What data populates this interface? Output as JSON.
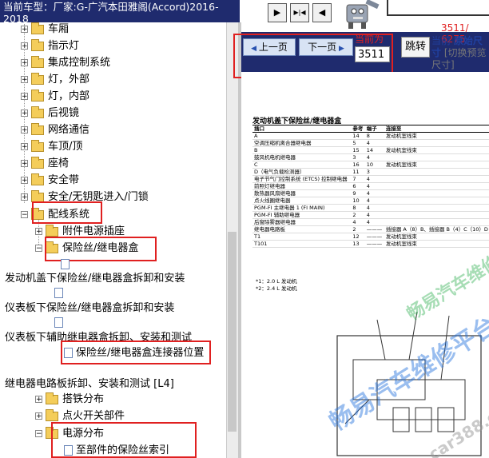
{
  "header": {
    "vehicle_label": "当前车型：",
    "vehicle_name": "厂家:G-广汽本田雅阁(Accord)2016-2018",
    "nav": [
      "▶",
      "▶|◀",
      "◀"
    ]
  },
  "tree": {
    "items": [
      {
        "label": "车厢"
      },
      {
        "label": "指示灯"
      },
      {
        "label": "集成控制系统"
      },
      {
        "label": "灯，外部"
      },
      {
        "label": "灯，内部"
      },
      {
        "label": "后视镜"
      },
      {
        "label": "网络通信"
      },
      {
        "label": "车顶/顶"
      },
      {
        "label": "座椅"
      },
      {
        "label": "安全带"
      },
      {
        "label": "安全/无钥匙进入/门锁"
      },
      {
        "label": "配线系统"
      },
      {
        "label": "附件电源插座"
      },
      {
        "label": "保险丝/继电器盒"
      }
    ],
    "leaves": [
      "发动机盖下保险丝/继电器盒拆卸和安装",
      "仪表板下保险丝/继电器盒拆卸和安装",
      "仪表板下辅助继电器盒拆卸、安装和测试",
      "保险丝/继电器盒连接器位置",
      "继电器电路板拆卸、安装和测试 [L4]"
    ],
    "items2": [
      {
        "label": "搭铁分布"
      },
      {
        "label": "点火开关部件"
      },
      {
        "label": "电源分布"
      },
      {
        "label": "至部件的保险丝索引"
      }
    ]
  },
  "toolbar": {
    "prev_label": "上一页",
    "next_label": "下一页",
    "page_label": "当前为",
    "page_value": "3511",
    "jump_label": "跳转",
    "page_count": "3511/ 6275",
    "size_prefix": "当前",
    "size_value": "原始尺寸",
    "size_toggle": "[切换预览尺寸]"
  },
  "document": {
    "title": "发动机盖下保险丝/继电器盒",
    "columns": [
      "插口",
      "参考",
      "端子",
      "连接至"
    ],
    "rows": [
      [
        "A",
        "14",
        "8",
        "发动机室线束"
      ],
      [
        "空调压缩机离合器继电器",
        "5",
        "4",
        ""
      ],
      [
        "B",
        "15",
        "14",
        "发动机室线束"
      ],
      [
        "鼓风机电机继电器",
        "3",
        "4",
        ""
      ],
      [
        "C",
        "16",
        "10",
        "发动机室线束"
      ],
      [
        "D（电气负载检测器）",
        "11",
        "3",
        ""
      ],
      [
        "电子节气门控制系统 (ETCS) 控制继电器",
        "7",
        "4",
        ""
      ],
      [
        "前照灯继电器",
        "6",
        "4",
        ""
      ],
      [
        "散热器风扇继电器",
        "9",
        "4",
        ""
      ],
      [
        "点火线圈继电器",
        "10",
        "4",
        ""
      ],
      [
        "PGM-FI 主继电器 1 (FI MAIN)",
        "8",
        "4",
        ""
      ],
      [
        "PGM-FI 辅助继电器",
        "2",
        "4",
        ""
      ],
      [
        "后窗除雾器继电器",
        "4",
        "4",
        ""
      ],
      [
        "继电器电路板",
        "2",
        "———",
        "插接器 A（8）B、插接器 B（4）C（10）D"
      ],
      [
        "T1",
        "12",
        "———",
        "发动机室线束"
      ],
      [
        "T101",
        "13",
        "———",
        "发动机室线束"
      ]
    ],
    "notes": [
      "*1：2.0 L 发动机",
      "*2：2.4 L 发动机"
    ]
  },
  "watermark": {
    "text1": "畅易汽车维修平台",
    "text2": "car388.com",
    "text3": "畅易汽车维修平"
  }
}
